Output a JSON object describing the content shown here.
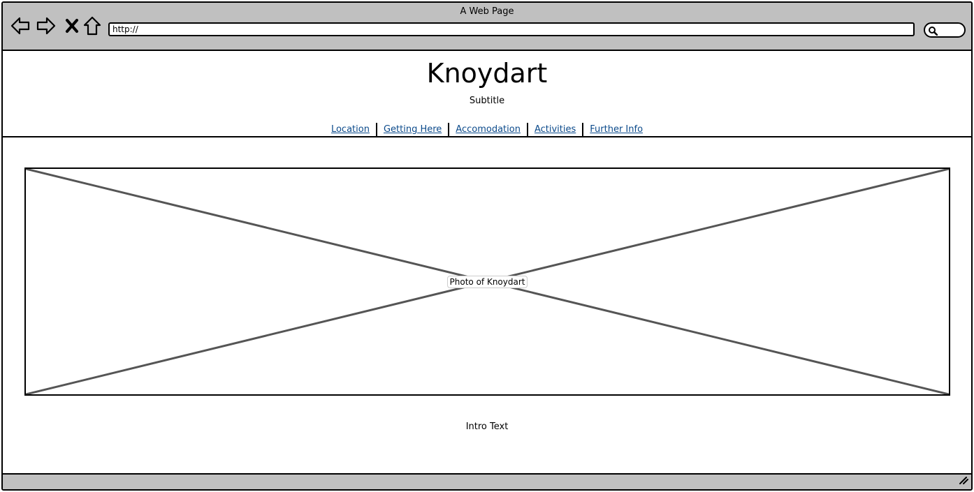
{
  "window": {
    "title": "A Web Page"
  },
  "toolbar": {
    "back_icon": "back-arrow-icon",
    "forward_icon": "forward-arrow-icon",
    "stop_icon": "stop-x-icon",
    "home_icon": "home-icon",
    "search_icon": "search-icon"
  },
  "address_bar": {
    "value": "http://"
  },
  "header": {
    "title": "Knoydart",
    "subtitle": "Subtitle",
    "nav": [
      {
        "label": "Location"
      },
      {
        "label": "Getting Here"
      },
      {
        "label": "Accomodation"
      },
      {
        "label": "Activities"
      },
      {
        "label": "Further Info"
      }
    ]
  },
  "main": {
    "photo_label": "Photo of Knoydart",
    "intro_text": "Intro Text"
  },
  "colors": {
    "chrome": "#c0c0c0",
    "link": "#0b4a8b",
    "placeholder_line": "#555555"
  }
}
